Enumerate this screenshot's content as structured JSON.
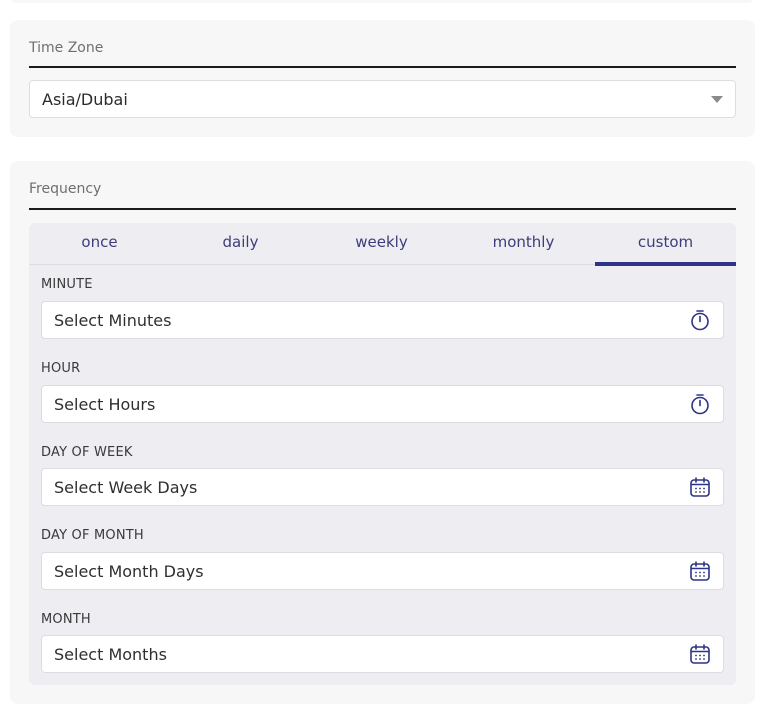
{
  "timezone": {
    "label": "Time Zone",
    "value": "Asia/Dubai"
  },
  "frequency": {
    "label": "Frequency",
    "tabs": [
      {
        "label": "once"
      },
      {
        "label": "daily"
      },
      {
        "label": "weekly"
      },
      {
        "label": "monthly"
      },
      {
        "label": "custom"
      }
    ],
    "active_tab": "custom",
    "fields": [
      {
        "label": "MINUTE",
        "placeholder": "Select Minutes",
        "icon": "stopwatch-icon"
      },
      {
        "label": "HOUR",
        "placeholder": "Select Hours",
        "icon": "stopwatch-icon"
      },
      {
        "label": "DAY OF WEEK",
        "placeholder": "Select Week Days",
        "icon": "calendar-icon"
      },
      {
        "label": "DAY OF MONTH",
        "placeholder": "Select Month Days",
        "icon": "calendar-icon"
      },
      {
        "label": "MONTH",
        "placeholder": "Select Months",
        "icon": "calendar-icon"
      }
    ]
  },
  "colors": {
    "accent": "#2e3386",
    "tab_text": "#3d3d7a",
    "panel_bg": "#ededf2",
    "card_bg": "#f7f7f7"
  }
}
